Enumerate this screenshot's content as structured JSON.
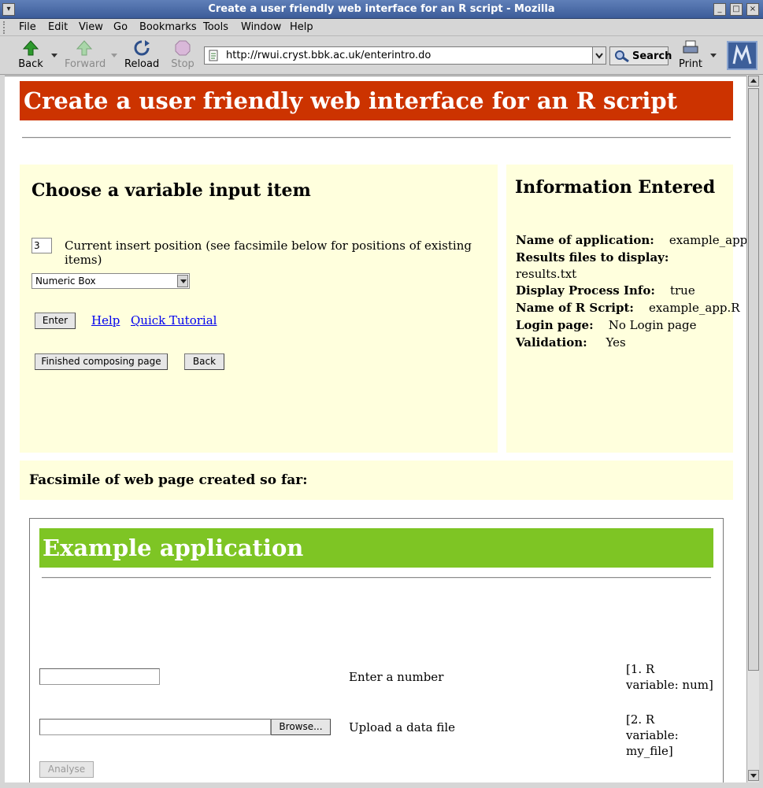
{
  "window": {
    "title": "Create a user friendly web interface for an R script - Mozilla"
  },
  "menu": {
    "file": "File",
    "edit": "Edit",
    "view": "View",
    "go": "Go",
    "bookmarks": "Bookmarks",
    "tools": "Tools",
    "window": "Window",
    "help": "Help"
  },
  "toolbar": {
    "back": "Back",
    "forward": "Forward",
    "reload": "Reload",
    "stop": "Stop",
    "url": "http://rwui.cryst.bbk.ac.uk/enterintro.do",
    "search": "Search",
    "print": "Print"
  },
  "page": {
    "banner": "Create a user friendly web interface for an R script",
    "choose": {
      "heading": "Choose a variable input item",
      "position_value": "3",
      "position_label": "Current insert position (see facsimile below for positions of existing items)",
      "select_value": "Numeric Box",
      "enter_button": "Enter",
      "help_link": "Help",
      "tutorial_link": "Quick Tutorial",
      "finished_button": "Finished composing page",
      "back_button": "Back"
    },
    "info": {
      "heading": "Information Entered",
      "app_name_label": "Name of application:",
      "app_name_value": "example_app",
      "results_label": "Results files to display:",
      "results_value": "results.txt",
      "process_label": "Display Process Info:",
      "process_value": "true",
      "script_label": "Name of R Script:",
      "script_value": "example_app.R",
      "login_label": "Login page:",
      "login_value": "No Login page",
      "validation_label": "Validation:",
      "validation_value": "Yes"
    },
    "facsimile": {
      "title": "Facsimile of web page created so far:",
      "app_banner": "Example application",
      "item1_label": "Enter a number",
      "item1_note_a": "[1.  R",
      "item1_note_b": "variable: num]",
      "item2_label": "Upload a data file",
      "item2_browse": "Browse...",
      "item2_note_a": "[2.  R",
      "item2_note_b": "variable: my_file]",
      "analyse_button": "Analyse"
    }
  }
}
